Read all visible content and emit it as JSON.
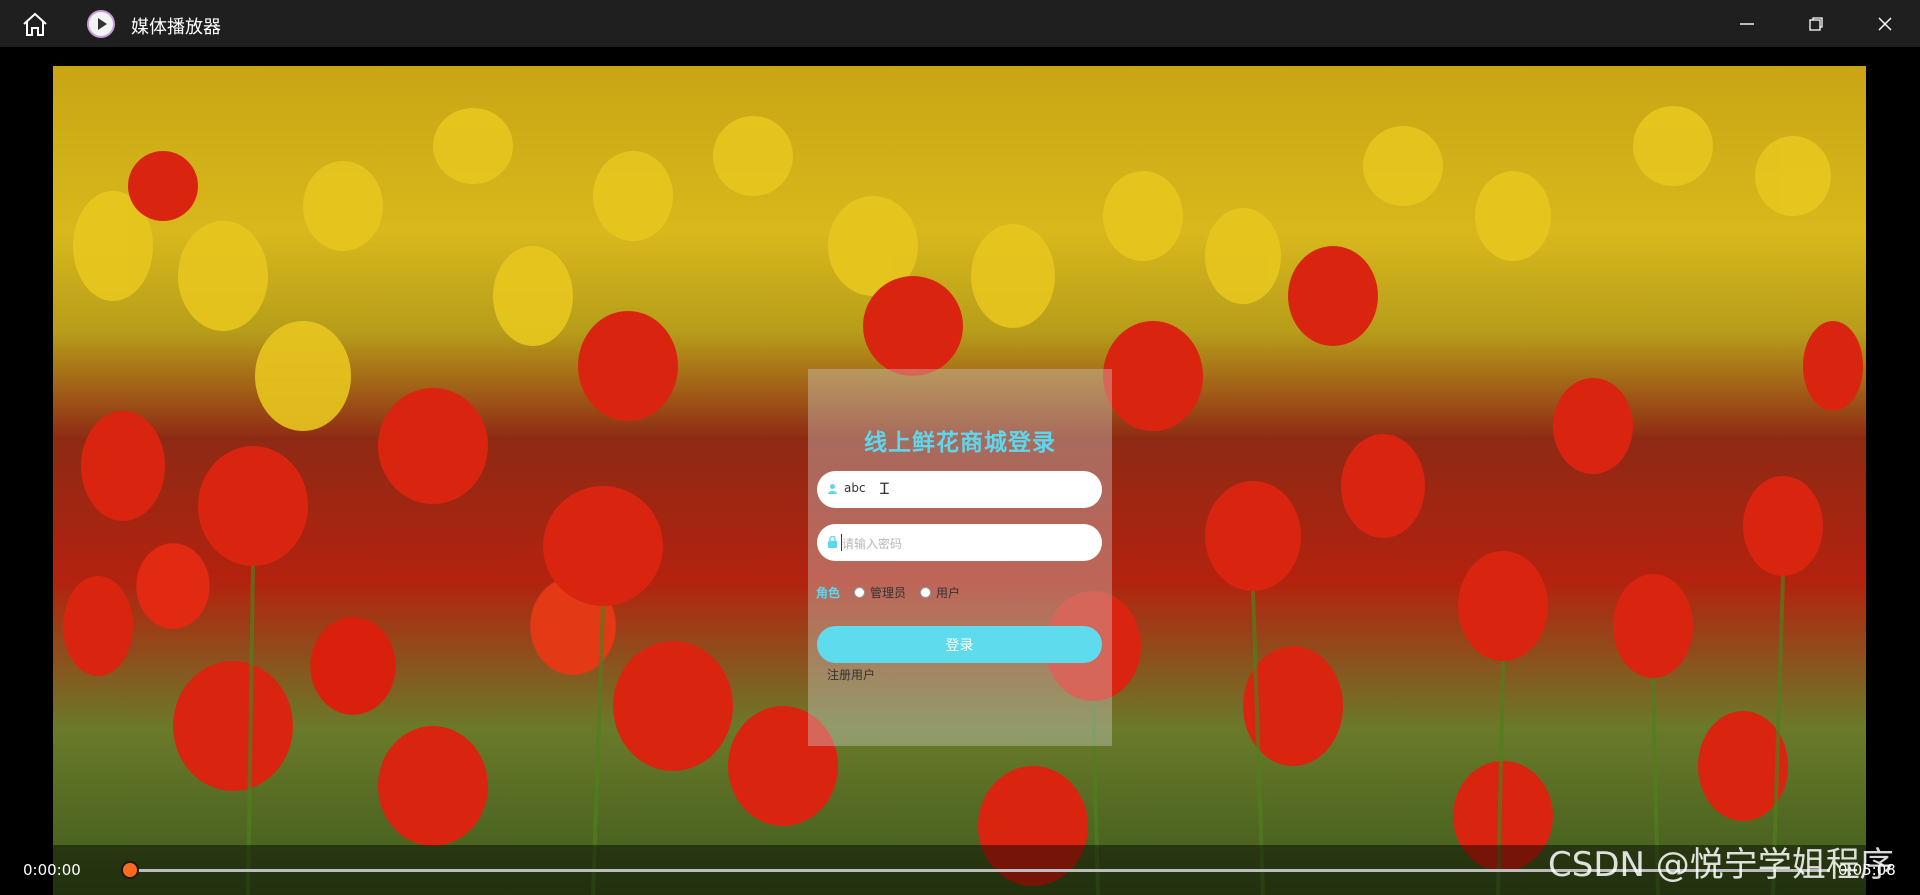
{
  "titlebar": {
    "title": "媒体播放器",
    "icons": [
      "home-icon",
      "play-circle-icon",
      "minimize-icon",
      "restore-icon",
      "close-icon"
    ]
  },
  "login": {
    "title": "线上鲜花商城登录",
    "username_value": "abc",
    "password_placeholder": "请输入密码",
    "role_label": "角色",
    "role_options": [
      "管理员",
      "用户"
    ],
    "login_button": "登录",
    "register_link": "注册用户"
  },
  "player": {
    "current_time": "0:00:00",
    "end_time": "0:05:08",
    "progress": 0
  },
  "watermark": "CSDN @悦宁学姐程序",
  "colors": {
    "accent_cyan": "#5fdbee",
    "seek_thumb": "#ff6a1f",
    "titlebar_bg": "#1f1f1f"
  }
}
